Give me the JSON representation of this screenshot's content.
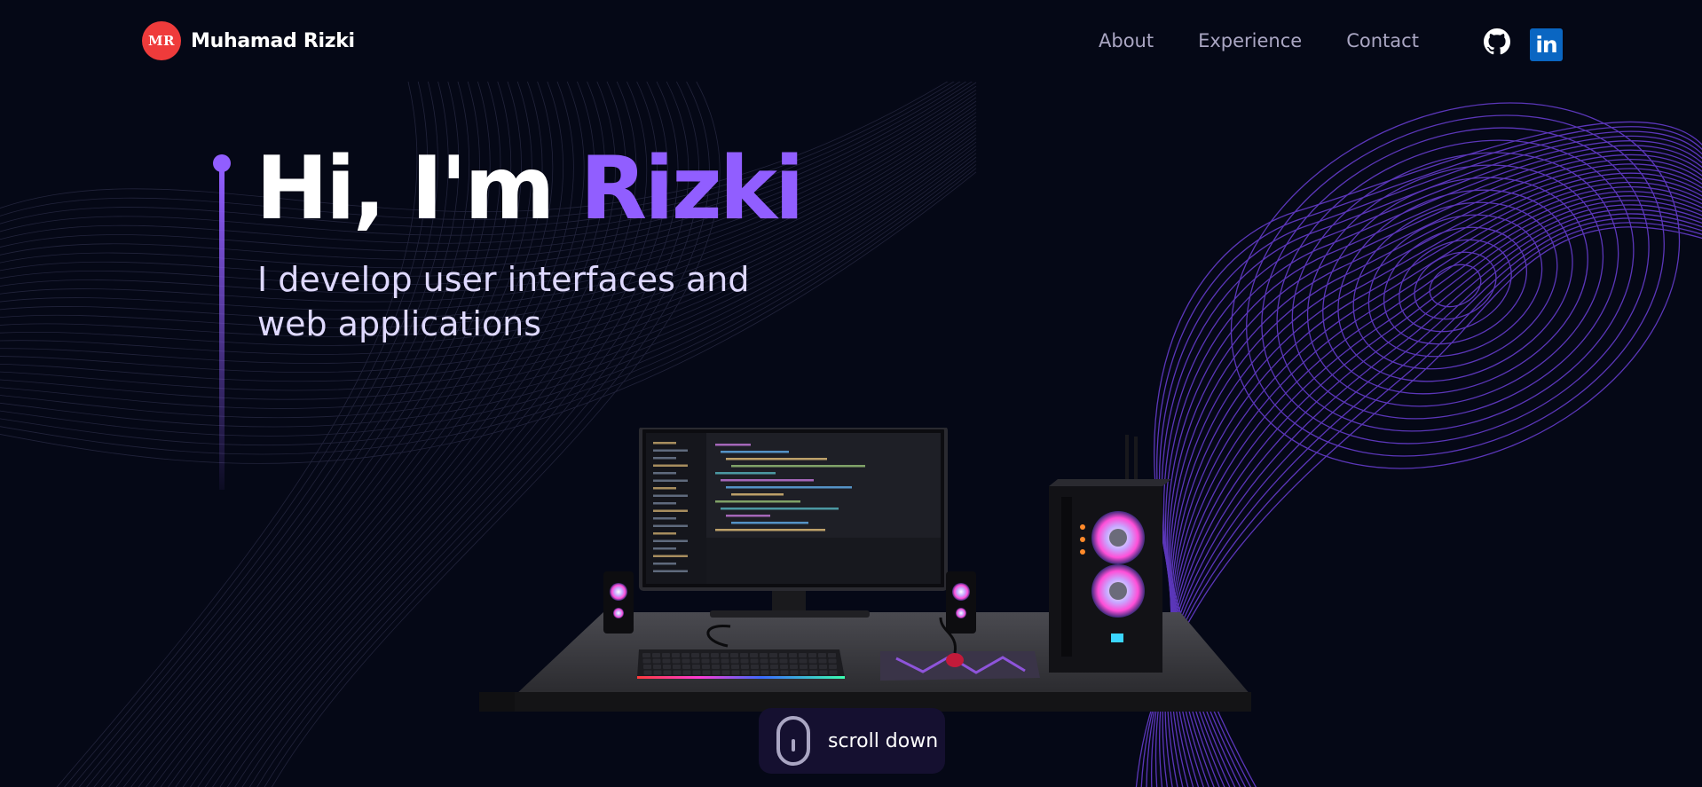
{
  "brand": {
    "initials": "MR",
    "name": "Muhamad Rizki"
  },
  "nav": {
    "links": [
      "About",
      "Experience",
      "Contact"
    ],
    "linkedin_text": "in"
  },
  "hero": {
    "greeting": "Hi, I'm ",
    "highlight_name": "Rizki",
    "subtitle": "I develop user interfaces and web applications"
  },
  "scroll": {
    "label": "scroll down"
  },
  "colors": {
    "background": "#050816",
    "accent": "#915eff",
    "logo_badge": "#ef3b3b",
    "nav_text": "#aaa6c3",
    "scroll_button_bg": "#151030",
    "linkedin": "#0a66c2"
  },
  "icons": {
    "github": "github-icon",
    "linkedin": "linkedin-icon",
    "scroll": "mouse-icon"
  }
}
